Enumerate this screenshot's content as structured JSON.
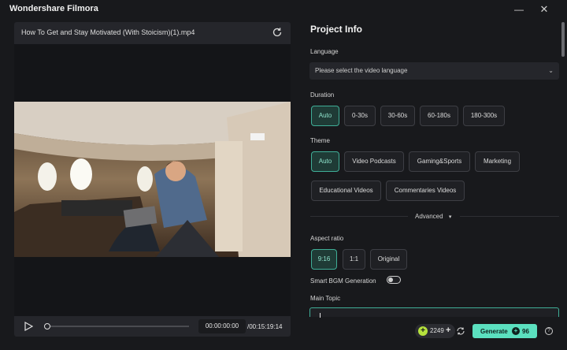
{
  "app": {
    "title": "Wondershare Filmora",
    "minimize_glyph": "—",
    "close_glyph": "✕"
  },
  "video": {
    "filename": "How To Get and Stay Motivated (With Stoicism)(1).mp4",
    "current_time": "00:00:00:00",
    "duration": "/00:15:19:14",
    "progress": 0
  },
  "project": {
    "title": "Project Info",
    "language": {
      "label": "Language",
      "placeholder": "Please select the video language",
      "chevron": "⌄"
    },
    "duration": {
      "label": "Duration",
      "options": [
        "Auto",
        "0-30s",
        "30-60s",
        "60-180s",
        "180-300s"
      ],
      "selected": "Auto"
    },
    "theme": {
      "label": "Theme",
      "options": [
        "Auto",
        "Video Podcasts",
        "Gaming&Sports",
        "Marketing",
        "Educational Videos",
        "Commentaries Videos"
      ],
      "selected": "Auto"
    },
    "advanced_label": "Advanced",
    "advanced_arrow": "▾",
    "aspect_ratio": {
      "label": "Aspect ratio",
      "options": [
        "9:16",
        "1:1",
        "Original"
      ],
      "selected": "9:16"
    },
    "smart_bgm": {
      "label": "Smart BGM Generation",
      "enabled": false
    },
    "main_topic": {
      "label": "Main Topic",
      "value": ""
    }
  },
  "footer": {
    "credits": "2249",
    "plus": "+",
    "generate_label": "Generate",
    "generate_cost": "96",
    "help": "?"
  },
  "colors": {
    "accent": "#5be0bf",
    "active_chip_border": "#3fae97",
    "background": "#18191c",
    "credit_coin": "#b6e23d"
  },
  "icons": [
    "refresh-icon",
    "play-icon",
    "chevron-down-icon",
    "coin-icon",
    "refresh-credits-icon",
    "help-icon",
    "close-icon",
    "minimize-icon"
  ]
}
